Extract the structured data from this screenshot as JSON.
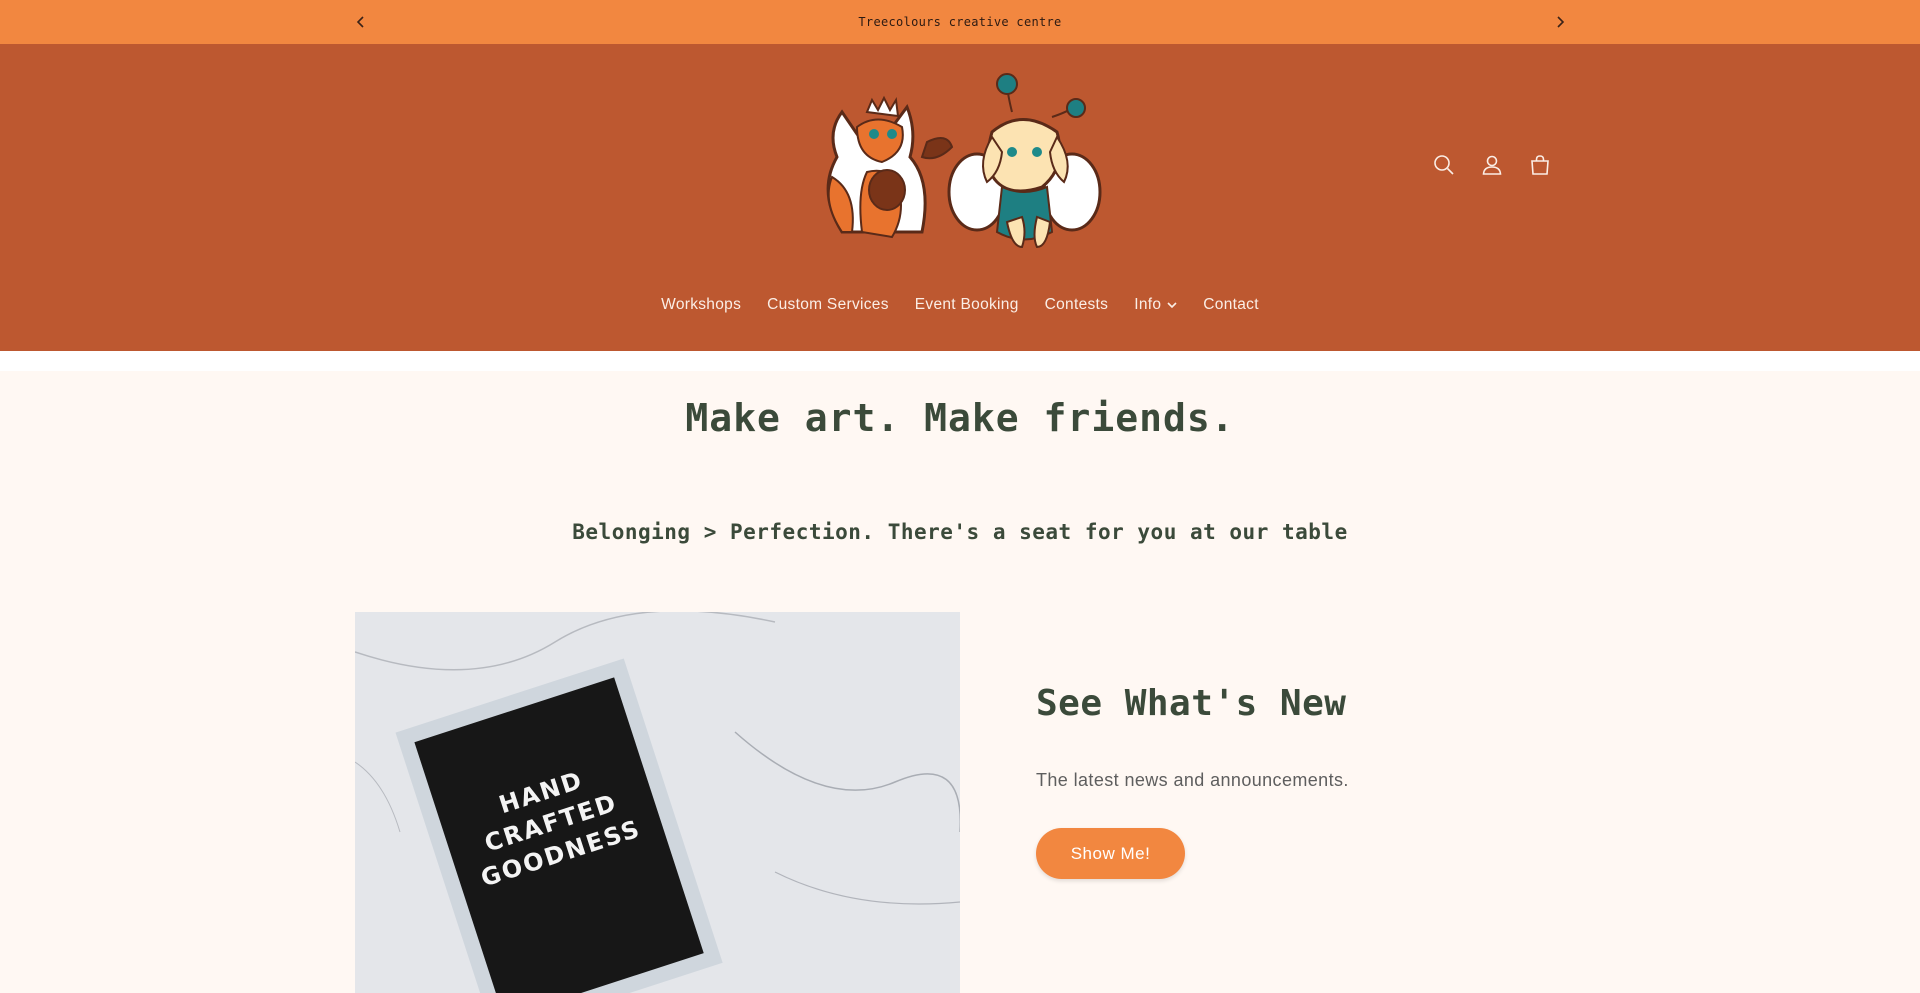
{
  "announcement": {
    "message": "Treecolours creative centre",
    "prev_icon": "chevron-left-icon",
    "next_icon": "chevron-right-icon"
  },
  "header": {
    "logo": "fox-and-puppy-mascots-logo",
    "icons": [
      "search-icon",
      "account-icon",
      "cart-icon"
    ]
  },
  "nav": {
    "items": [
      {
        "label": "Workshops"
      },
      {
        "label": "Custom Services"
      },
      {
        "label": "Event Booking"
      },
      {
        "label": "Contests"
      },
      {
        "label": "Info",
        "has_dropdown": true
      },
      {
        "label": "Contact"
      }
    ]
  },
  "main": {
    "headline": "Make art. Make friends.",
    "subheadline": "Belonging > Perfection. There's a seat for you at our table",
    "feature": {
      "image_text": "HAND CRAFTED GOODNESS",
      "title": "See What's New",
      "text": "The latest news and announcements.",
      "button_label": "Show Me!"
    }
  },
  "colors": {
    "announcement_bg": "#f28740",
    "header_bg": "#bd5830",
    "page_bg": "#fff8f3",
    "heading_text": "#3b4a3a",
    "button_bg": "#f28740"
  }
}
